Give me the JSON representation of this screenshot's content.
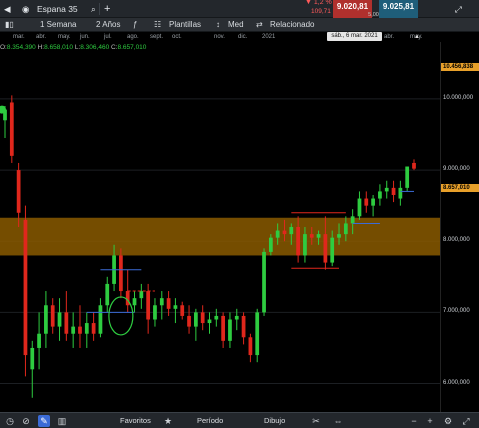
{
  "topbar": {
    "instrument": "Espana 35",
    "change_pct": "▼ 1,2 %",
    "change_abs": "109,71",
    "sell_price": "9.020,81",
    "spread": "5,00",
    "buy_price": "9.025,81"
  },
  "toolbar": {
    "interval": "1 Semana",
    "range": "2 Años",
    "templates": "Plantillas",
    "price_type": "Med",
    "related": "Relacionado"
  },
  "ohlc": {
    "o_label": "O:",
    "o": "8.354,390",
    "h_label": "H:",
    "h": "8.658,010",
    "l_label": "L:",
    "l": "8.306,460",
    "c_label": "C:",
    "c": "8.657,010"
  },
  "crosshair_date": "sáb., 6 mar. 2021",
  "price_tags": {
    "high": "10.456,838",
    "last": "8.657,010"
  },
  "bottom": {
    "favorites": "Favoritos",
    "period": "Período",
    "drawing": "Dibujo"
  },
  "colors": {
    "up": "#2ecc40",
    "down": "#e0271c",
    "zone": "#8a5a00",
    "accent": "#e8a02a"
  },
  "chart_data": {
    "type": "candlestick",
    "x_tick_labels": [
      "mar.",
      "abr.",
      "may.",
      "jun.",
      "jul.",
      "ago.",
      "sept.",
      "oct.",
      "nov.",
      "dic.",
      "2021",
      "abr.",
      "may."
    ],
    "y_tick_labels": [
      "10.000,000",
      "9.000,000",
      "8.000,000",
      "7.000,000",
      "6.000,000"
    ],
    "y_ticks": [
      10000,
      9000,
      8000,
      7000,
      6000
    ],
    "ylim": [
      5600,
      10800
    ],
    "zone": [
      7800,
      8330
    ],
    "candles": [
      {
        "o": 9700,
        "h": 9900,
        "l": 9450,
        "c": 9850
      },
      {
        "o": 9950,
        "h": 10050,
        "l": 9100,
        "c": 9200
      },
      {
        "o": 9000,
        "h": 9100,
        "l": 8200,
        "c": 8400
      },
      {
        "o": 8300,
        "h": 8500,
        "l": 6100,
        "c": 6400
      },
      {
        "o": 6200,
        "h": 6600,
        "l": 5800,
        "c": 6500
      },
      {
        "o": 6500,
        "h": 7000,
        "l": 6200,
        "c": 6700
      },
      {
        "o": 6700,
        "h": 7300,
        "l": 6500,
        "c": 7100
      },
      {
        "o": 7100,
        "h": 7200,
        "l": 6700,
        "c": 6800
      },
      {
        "o": 6800,
        "h": 7200,
        "l": 6600,
        "c": 7000
      },
      {
        "o": 7000,
        "h": 7300,
        "l": 6600,
        "c": 6700
      },
      {
        "o": 6700,
        "h": 7000,
        "l": 6500,
        "c": 6800
      },
      {
        "o": 6800,
        "h": 7100,
        "l": 6500,
        "c": 6700
      },
      {
        "o": 6700,
        "h": 7000,
        "l": 6500,
        "c": 6850
      },
      {
        "o": 6850,
        "h": 7000,
        "l": 6600,
        "c": 6700
      },
      {
        "o": 6700,
        "h": 7200,
        "l": 6650,
        "c": 7100
      },
      {
        "o": 7100,
        "h": 7500,
        "l": 7000,
        "c": 7400
      },
      {
        "o": 7400,
        "h": 7950,
        "l": 7300,
        "c": 7800
      },
      {
        "o": 7800,
        "h": 7900,
        "l": 7200,
        "c": 7300
      },
      {
        "o": 7300,
        "h": 7600,
        "l": 7000,
        "c": 7100
      },
      {
        "o": 7100,
        "h": 7300,
        "l": 7000,
        "c": 7200
      },
      {
        "o": 7200,
        "h": 7400,
        "l": 7050,
        "c": 7300
      },
      {
        "o": 7300,
        "h": 7400,
        "l": 6700,
        "c": 6900
      },
      {
        "o": 6900,
        "h": 7200,
        "l": 6800,
        "c": 7100
      },
      {
        "o": 7100,
        "h": 7300,
        "l": 6900,
        "c": 7200
      },
      {
        "o": 7200,
        "h": 7300,
        "l": 6950,
        "c": 7050
      },
      {
        "o": 7050,
        "h": 7200,
        "l": 6850,
        "c": 7100
      },
      {
        "o": 7100,
        "h": 7150,
        "l": 6900,
        "c": 6950
      },
      {
        "o": 6950,
        "h": 7100,
        "l": 6700,
        "c": 6800
      },
      {
        "o": 6800,
        "h": 7050,
        "l": 6600,
        "c": 7000
      },
      {
        "o": 7000,
        "h": 7100,
        "l": 6750,
        "c": 6850
      },
      {
        "o": 6850,
        "h": 7000,
        "l": 6700,
        "c": 6900
      },
      {
        "o": 6900,
        "h": 7050,
        "l": 6800,
        "c": 6950
      },
      {
        "o": 6950,
        "h": 7000,
        "l": 6500,
        "c": 6600
      },
      {
        "o": 6600,
        "h": 7000,
        "l": 6500,
        "c": 6900
      },
      {
        "o": 6900,
        "h": 7050,
        "l": 6750,
        "c": 6950
      },
      {
        "o": 6950,
        "h": 7000,
        "l": 6550,
        "c": 6650
      },
      {
        "o": 6650,
        "h": 6700,
        "l": 6300,
        "c": 6400
      },
      {
        "o": 6400,
        "h": 7050,
        "l": 6300,
        "c": 7000
      },
      {
        "o": 7000,
        "h": 7900,
        "l": 6950,
        "c": 7850
      },
      {
        "o": 7850,
        "h": 8100,
        "l": 7800,
        "c": 8050
      },
      {
        "o": 8050,
        "h": 8250,
        "l": 7950,
        "c": 8150
      },
      {
        "o": 8150,
        "h": 8300,
        "l": 8000,
        "c": 8100
      },
      {
        "o": 8100,
        "h": 8250,
        "l": 7950,
        "c": 8200
      },
      {
        "o": 8200,
        "h": 8350,
        "l": 7700,
        "c": 7800
      },
      {
        "o": 7800,
        "h": 8200,
        "l": 7700,
        "c": 8100
      },
      {
        "o": 8100,
        "h": 8200,
        "l": 7950,
        "c": 8050
      },
      {
        "o": 8050,
        "h": 8150,
        "l": 7950,
        "c": 8100
      },
      {
        "o": 8100,
        "h": 8350,
        "l": 7600,
        "c": 7700
      },
      {
        "o": 7700,
        "h": 8150,
        "l": 7650,
        "c": 8050
      },
      {
        "o": 8050,
        "h": 8250,
        "l": 7950,
        "c": 8100
      },
      {
        "o": 8100,
        "h": 8350,
        "l": 8000,
        "c": 8250
      },
      {
        "o": 8250,
        "h": 8450,
        "l": 8100,
        "c": 8350
      },
      {
        "o": 8350,
        "h": 8700,
        "l": 8300,
        "c": 8600
      },
      {
        "o": 8600,
        "h": 8700,
        "l": 8400,
        "c": 8500
      },
      {
        "o": 8500,
        "h": 8650,
        "l": 8350,
        "c": 8600
      },
      {
        "o": 8600,
        "h": 8800,
        "l": 8500,
        "c": 8700
      },
      {
        "o": 8700,
        "h": 8850,
        "l": 8600,
        "c": 8750
      },
      {
        "o": 8750,
        "h": 8850,
        "l": 8550,
        "c": 8650
      },
      {
        "o": 8600,
        "h": 8850,
        "l": 8500,
        "c": 8750
      },
      {
        "o": 8750,
        "h": 9050,
        "l": 8700,
        "c": 9050
      },
      {
        "o": 9100,
        "h": 9150,
        "l": 9000,
        "c": 9020
      }
    ]
  }
}
